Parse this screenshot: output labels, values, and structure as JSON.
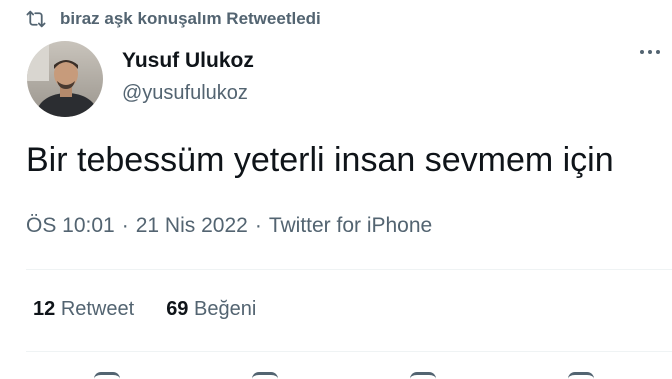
{
  "retweet": {
    "text": "biraz aşk konuşalım Retweetledi",
    "icon": "retweet-icon"
  },
  "user": {
    "display_name": "Yusuf Ulukoz",
    "handle": "@yusufulukoz",
    "avatar": "avatar-photo"
  },
  "tweet": {
    "text": "Bir tebessüm yeterli insan sevmem için",
    "time": "ÖS 10:01",
    "date": "21 Nis 2022",
    "source": "Twitter for iPhone",
    "separator": "·"
  },
  "stats": {
    "retweet_count": "12",
    "retweet_label": "Retweet",
    "like_count": "69",
    "like_label": "Beğeni"
  },
  "colors": {
    "text": "#0f1419",
    "secondary": "#536471",
    "divider": "#eff3f4"
  }
}
